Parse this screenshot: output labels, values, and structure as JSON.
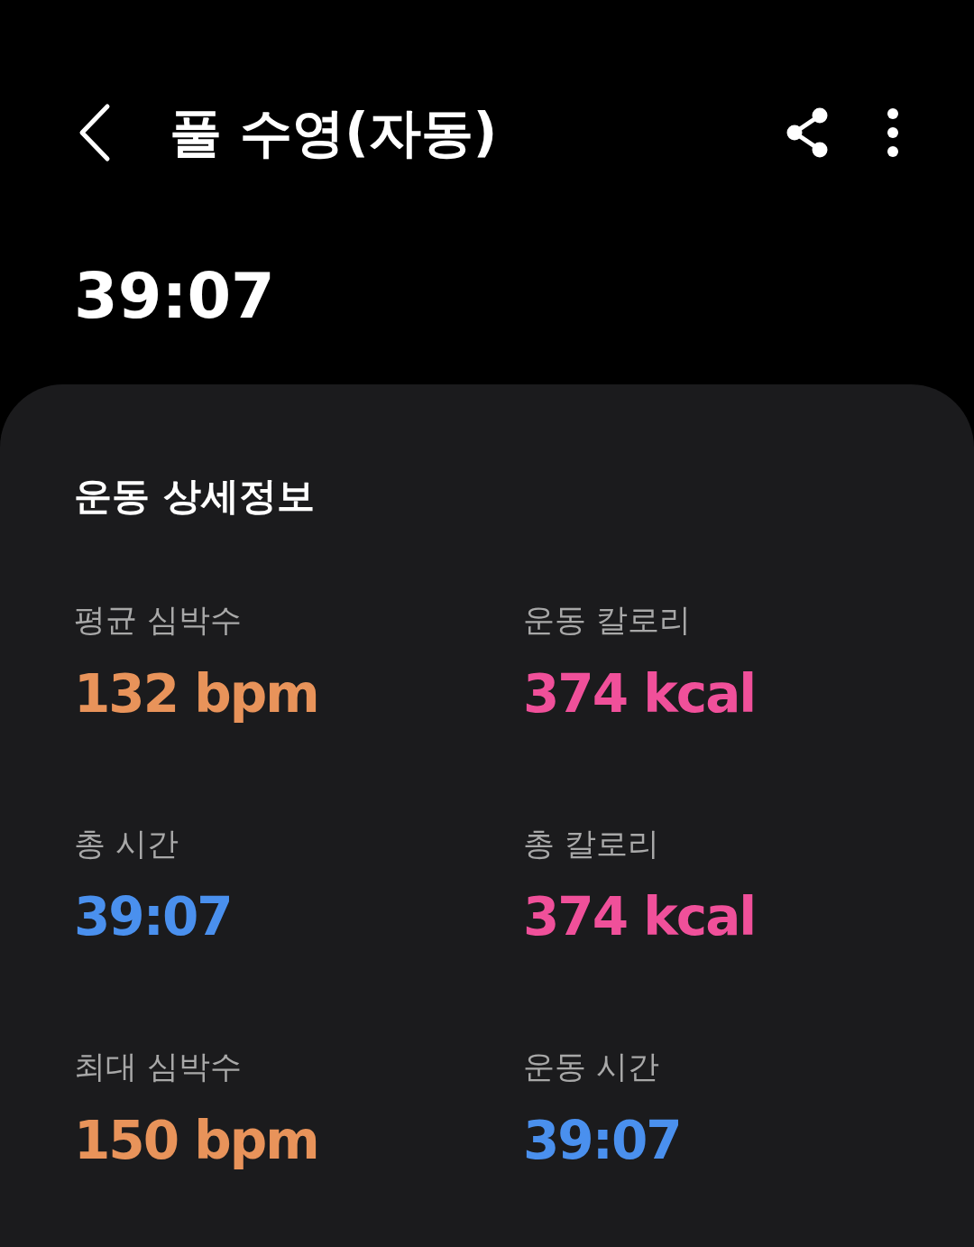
{
  "header": {
    "title": "풀 수영(자동)"
  },
  "duration": "39:07",
  "details": {
    "title": "운동 상세정보",
    "items": [
      {
        "label": "평균 심박수",
        "value": "132 bpm",
        "color": "#e8935a"
      },
      {
        "label": "운동 칼로리",
        "value": "374 kcal",
        "color": "#f0509a"
      },
      {
        "label": "총 시간",
        "value": "39:07",
        "color": "#4a90ee"
      },
      {
        "label": "총 칼로리",
        "value": "374 kcal",
        "color": "#f0509a"
      },
      {
        "label": "최대 심박수",
        "value": "150 bpm",
        "color": "#e8935a"
      },
      {
        "label": "운동 시간",
        "value": "39:07",
        "color": "#4a90ee"
      }
    ]
  }
}
